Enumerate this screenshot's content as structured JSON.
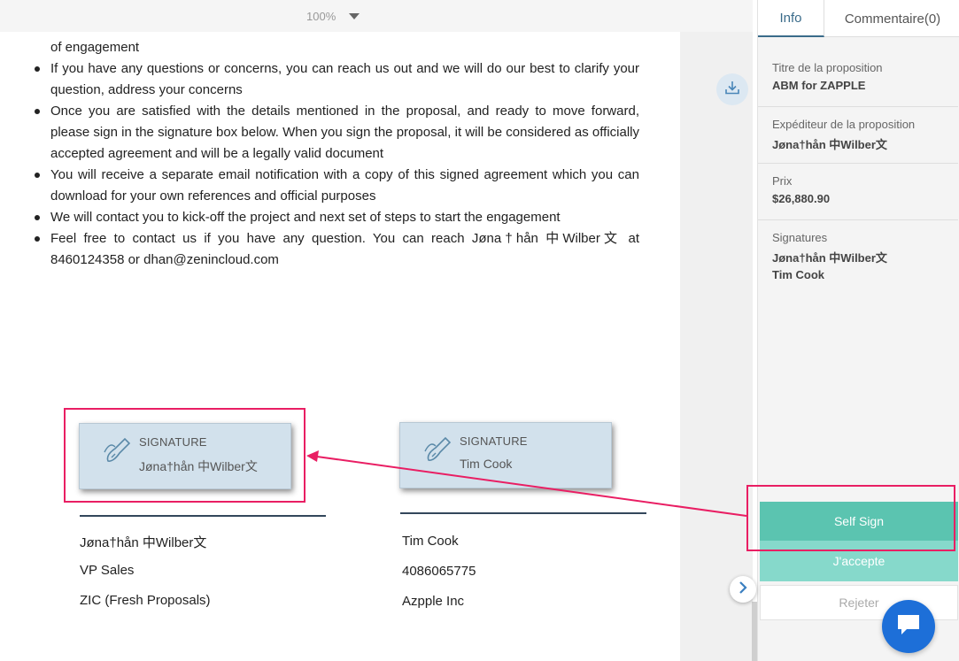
{
  "zoom": {
    "level": "100%"
  },
  "document": {
    "first_fragment": "of engagement",
    "bullets": [
      "If you have any questions or concerns, you can reach us out and we will do our best to clarify your question, address your concerns",
      "Once you are satisfied with the details mentioned in the proposal, and ready to move forward, please sign in the signature box below. When you sign the proposal, it will be considered as officially accepted agreement and will be a legally valid document",
      "You will receive a separate email notification with a copy of this signed agreement which you can download for your own references and official purposes",
      "We will contact you to kick-off the project and next set of steps to start the engagement",
      "Feel free to contact us if you have any question. You can reach Jøna†hån 中Wilber文 at 8460124358 or dhan@zenincloud.com"
    ]
  },
  "signatures": [
    {
      "box_title": "SIGNATURE",
      "box_name": "Jøna†hån 中Wilber文",
      "signer_name": "Jøna†hån  中Wilber文",
      "signer_role": "VP Sales",
      "signer_company": "ZIC (Fresh Proposals)"
    },
    {
      "box_title": "SIGNATURE",
      "box_name": "Tim  Cook",
      "signer_name": "Tim Cook",
      "signer_role": "4086065775",
      "signer_company": "Azpple Inc"
    }
  ],
  "side_panel": {
    "tabs": {
      "info": "Info",
      "comments": "Commentaire(0)"
    },
    "proposal_title_label": "Titre de la proposition",
    "proposal_title": "ABM for ZAPPLE",
    "sender_label": "Expéditeur de la proposition",
    "sender": "Jøna†hån 中Wilber文",
    "price_label": "Prix",
    "price": "$26,880.90",
    "signatures_label": "Signatures",
    "signers": [
      "Jøna†hån 中Wilber文",
      "Tim Cook"
    ],
    "buttons": {
      "self_sign": "Self Sign",
      "accept": "J'accepte",
      "reject": "Rejeter"
    }
  },
  "icons": {
    "zoom_caret": "chevron-down-icon",
    "download": "download-icon",
    "signature": "pen-icon",
    "expand": "chevron-right-icon",
    "chat": "chat-icon"
  },
  "colors": {
    "accent": "#3a6b8a",
    "self_sign": "#5bc4b0",
    "accept": "#86d9cb",
    "highlight": "#e91e63",
    "chat": "#1d6fd8"
  }
}
